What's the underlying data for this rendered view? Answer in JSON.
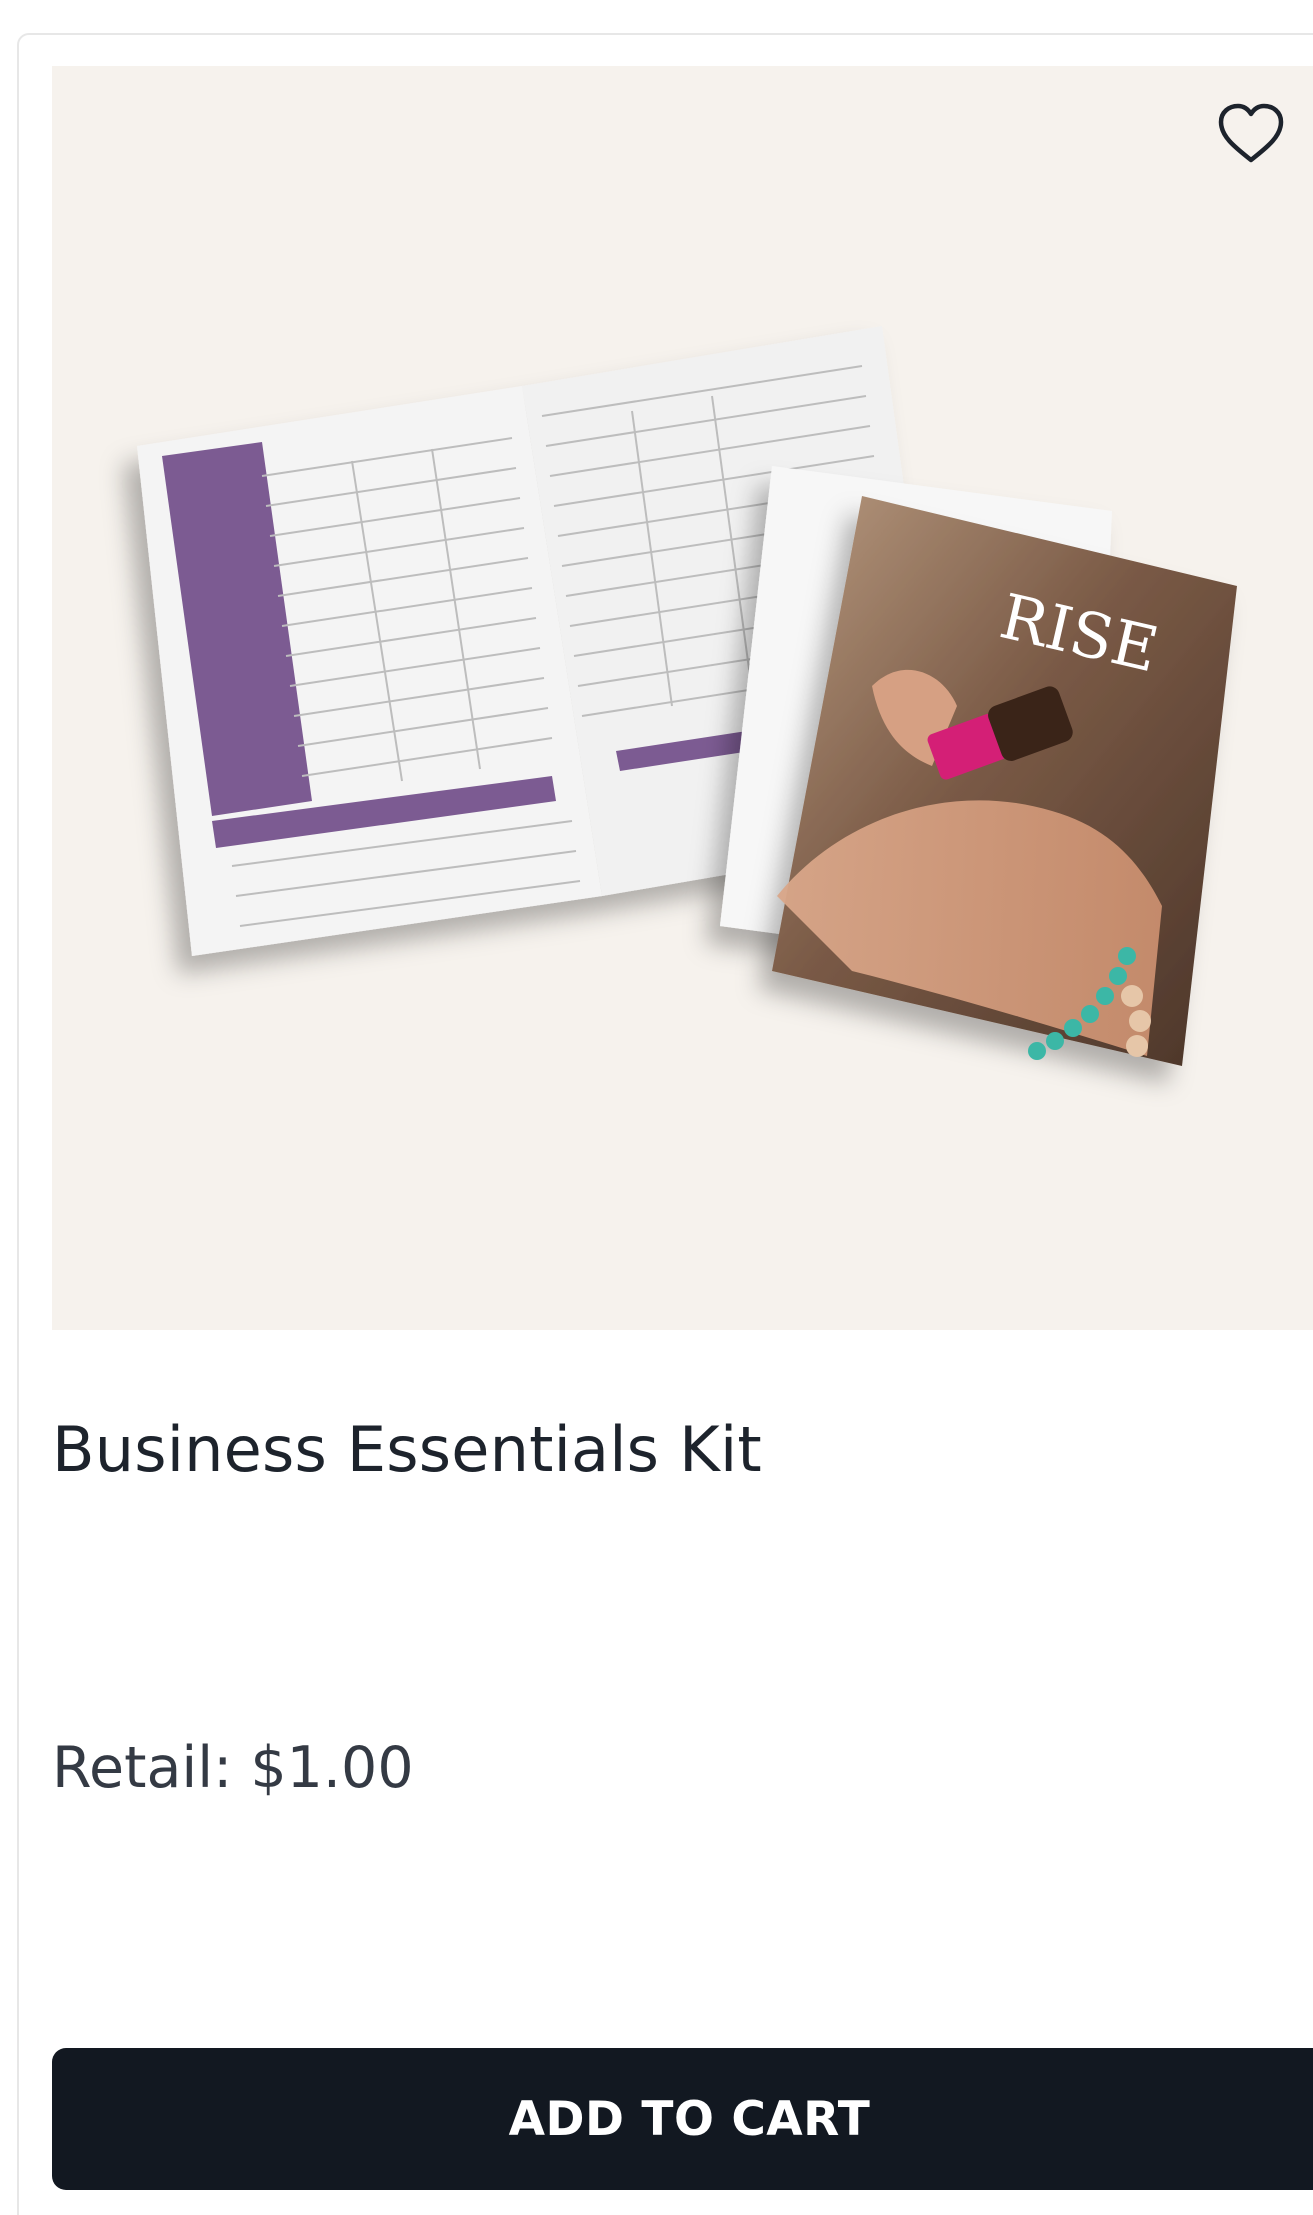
{
  "product": {
    "title": "Business Essentials Kit",
    "price_label": "Retail:",
    "price_value": "$1.00",
    "add_to_cart_label": "ADD TO CART",
    "favorite_icon": "heart-outline-icon",
    "image": {
      "booklet_cover_text": "RISE"
    }
  },
  "colors": {
    "image_background": "#f6f2ed",
    "button_background": "#121821",
    "accent_purple": "#7c5b92"
  }
}
